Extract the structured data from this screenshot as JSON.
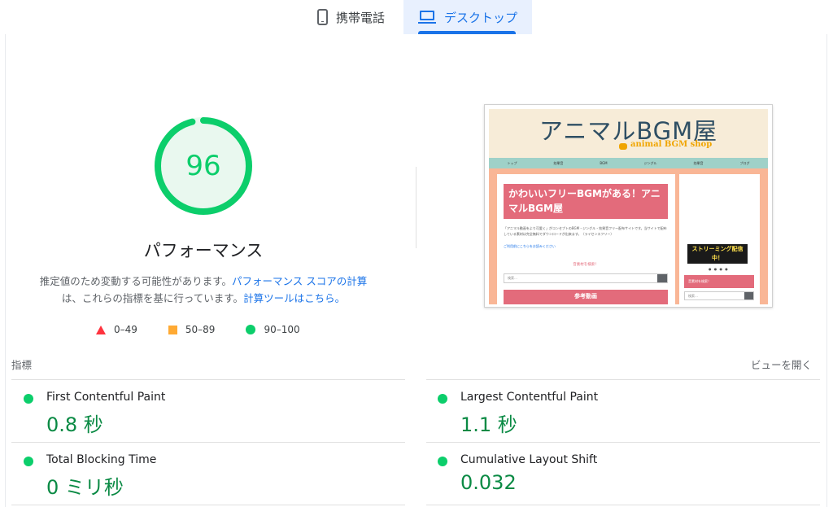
{
  "tabs": {
    "mobile": {
      "label": "携帯電話",
      "icon": "mobile-phone-icon"
    },
    "desktop": {
      "label": "デスクトップ",
      "icon": "laptop-icon",
      "selected": true
    }
  },
  "score": {
    "value": "96",
    "value_number": 96,
    "title": "パフォーマンス",
    "description_prefix": "推定値のため変動する可能性があります。",
    "description_link": "パフォーマンス スコアの計算",
    "description_mid": "は、これらの指標を基に行っています。",
    "calculator_link": "計算ツールはこちら。",
    "color": "#0cce6b"
  },
  "legend": {
    "fail": {
      "range": "0–49",
      "color": "#ff333e"
    },
    "average": {
      "range": "50–89",
      "color": "#ffaa33"
    },
    "pass": {
      "range": "90–100",
      "color": "#0cce6b"
    }
  },
  "metrics": {
    "header": "指標",
    "expand_link": "ビューを開く",
    "items": [
      {
        "label": "First Contentful Paint",
        "value": "0.8 秒"
      },
      {
        "label": "Largest Contentful Paint",
        "value": "1.1 秒"
      },
      {
        "label": "Total Blocking Time",
        "value": "0 ミリ秒"
      },
      {
        "label": "Cumulative Layout Shift",
        "value": "0.032"
      }
    ]
  },
  "screenshot": {
    "logo": "アニマルBGM屋",
    "logo_sub": "animal BGM shop",
    "nav": [
      "トップ",
      "効果音",
      "BGM",
      "ジングル",
      "効果音",
      "ブログ"
    ],
    "post_title": "かわいいフリーBGMがある！アニマルBGM屋",
    "post_text": "「アニマル動画をより可愛く」がコンセプトのBGM・ジングル・効果音フリー配布サイトです。当サイトで配布している素材は完全無料でダウンロードが出来ます。（ライセンスフリー）",
    "post_link": "ご利用前にこちらをお読みください",
    "search_heading": "音素材を検索！",
    "search_placeholder": "検索…",
    "ref_button": "参考動画",
    "banner": "ストリーミング配信中！",
    "side_heading": "音素材を検索！",
    "side_search_placeholder": "検索…"
  }
}
